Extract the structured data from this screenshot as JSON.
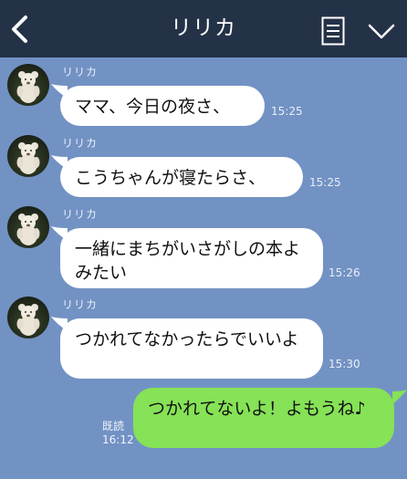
{
  "header": {
    "title": "リリカ",
    "back_icon": "chevron-left-icon",
    "menu_icon": "notes-icon",
    "collapse_icon": "chevron-down-icon"
  },
  "messages": [
    {
      "sender": "リリカ",
      "text": "ママ、今日の夜さ、",
      "time": "15:25"
    },
    {
      "sender": "リリカ",
      "text": "こうちゃんが寝たらさ、",
      "time": "15:25"
    },
    {
      "sender": "リリカ",
      "text": "一緒にまちがいさがしの本よみたい",
      "time": "15:26"
    },
    {
      "sender": "リリカ",
      "text": "つかれてなかったらでいいよ",
      "time": "15:30"
    }
  ],
  "outgoing": {
    "text": "つかれてないよ！よもうね♪",
    "read_label": "既読",
    "time": "16:12"
  },
  "colors": {
    "header_bg": "#243247",
    "chat_bg": "#7292c4",
    "incoming_bubble": "#ffffff",
    "outgoing_bubble": "#86e256"
  }
}
